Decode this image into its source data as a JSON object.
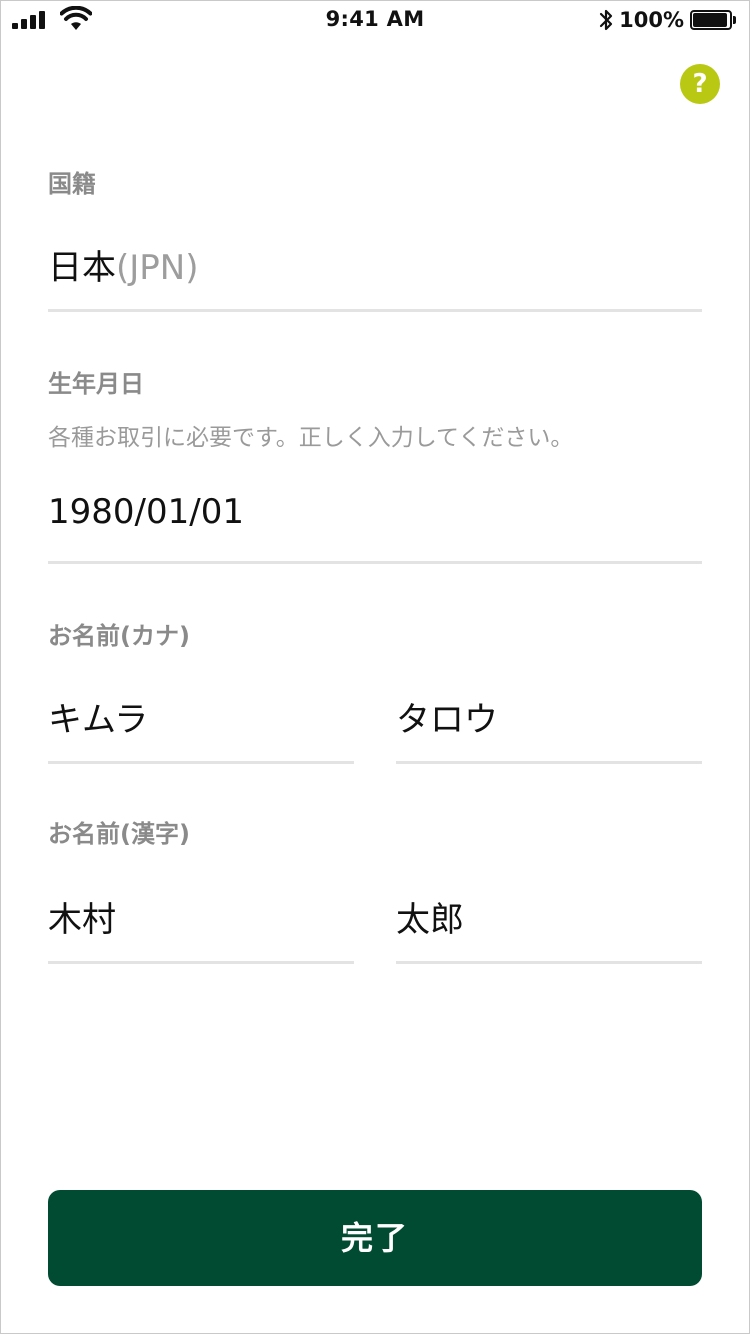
{
  "status_bar": {
    "time": "9:41 AM",
    "battery_percent": "100%"
  },
  "help": {
    "icon_label": "?"
  },
  "nationality": {
    "label": "国籍",
    "value": "日本",
    "code": "(JPN)"
  },
  "birthdate": {
    "label": "生年月日",
    "hint": "各種お取引に必要です。正しく入力してください。",
    "value": "1980/01/01"
  },
  "name_kana": {
    "label": "お名前(カナ)",
    "last": "キムラ",
    "first": "タロウ"
  },
  "name_kanji": {
    "label": "お名前(漢字)",
    "last": "木村",
    "first": "太郎"
  },
  "submit": {
    "label": "完了"
  },
  "colors": {
    "primary_button": "#004b31",
    "help_accent": "#b9c812",
    "label_gray": "#8a8a8a",
    "divider": "#e3e3e3"
  }
}
